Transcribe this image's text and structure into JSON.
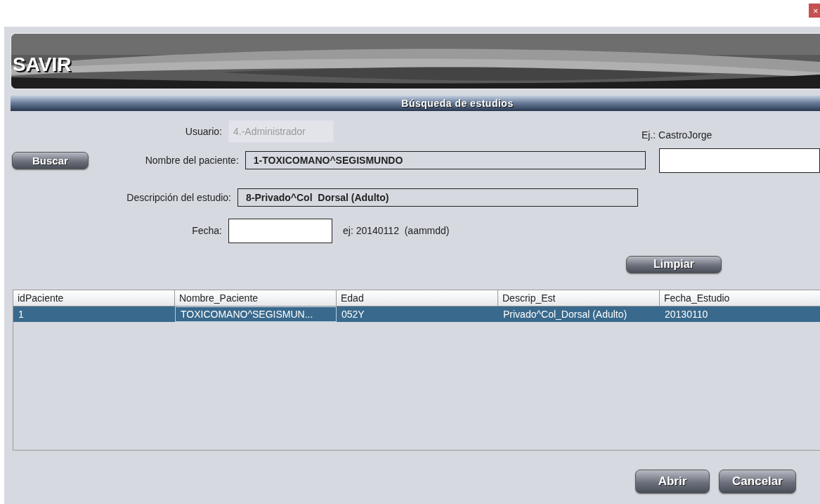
{
  "window": {
    "close": "×"
  },
  "banner": {
    "title": "SAVIR"
  },
  "section": {
    "title": "Búsqueda de estudios"
  },
  "form": {
    "user_label": "Usuario:",
    "user_value": "4.-Administrador",
    "user_disabled": true,
    "example": "Ej.: CastroJorge",
    "search_button": "Buscar",
    "patient_label": "Nombre del paciente:",
    "patient_value": "1-TOXICOMANO^SEGISMUNDO",
    "study_label": "Descripción del estudio:",
    "study_value": "8-Privado^Col  Dorsal (Adulto)",
    "date_label": "Fecha:",
    "date_hint": "ej: 20140112  (aammdd)",
    "clear_button": "Limpiar"
  },
  "table": {
    "columns": [
      "idPaciente",
      "Nombre_Paciente",
      "Edad",
      "Descrip_Est",
      "Fecha_Estudio"
    ],
    "rows": [
      {
        "cells": [
          "1",
          "TOXICOMANO^SEGISMUN...",
          "052Y",
          "Privado^Col_Dorsal (Adulto)",
          "20130110"
        ],
        "selected": true
      }
    ]
  },
  "buttons": [
    "Abrir",
    "Cancelar"
  ]
}
